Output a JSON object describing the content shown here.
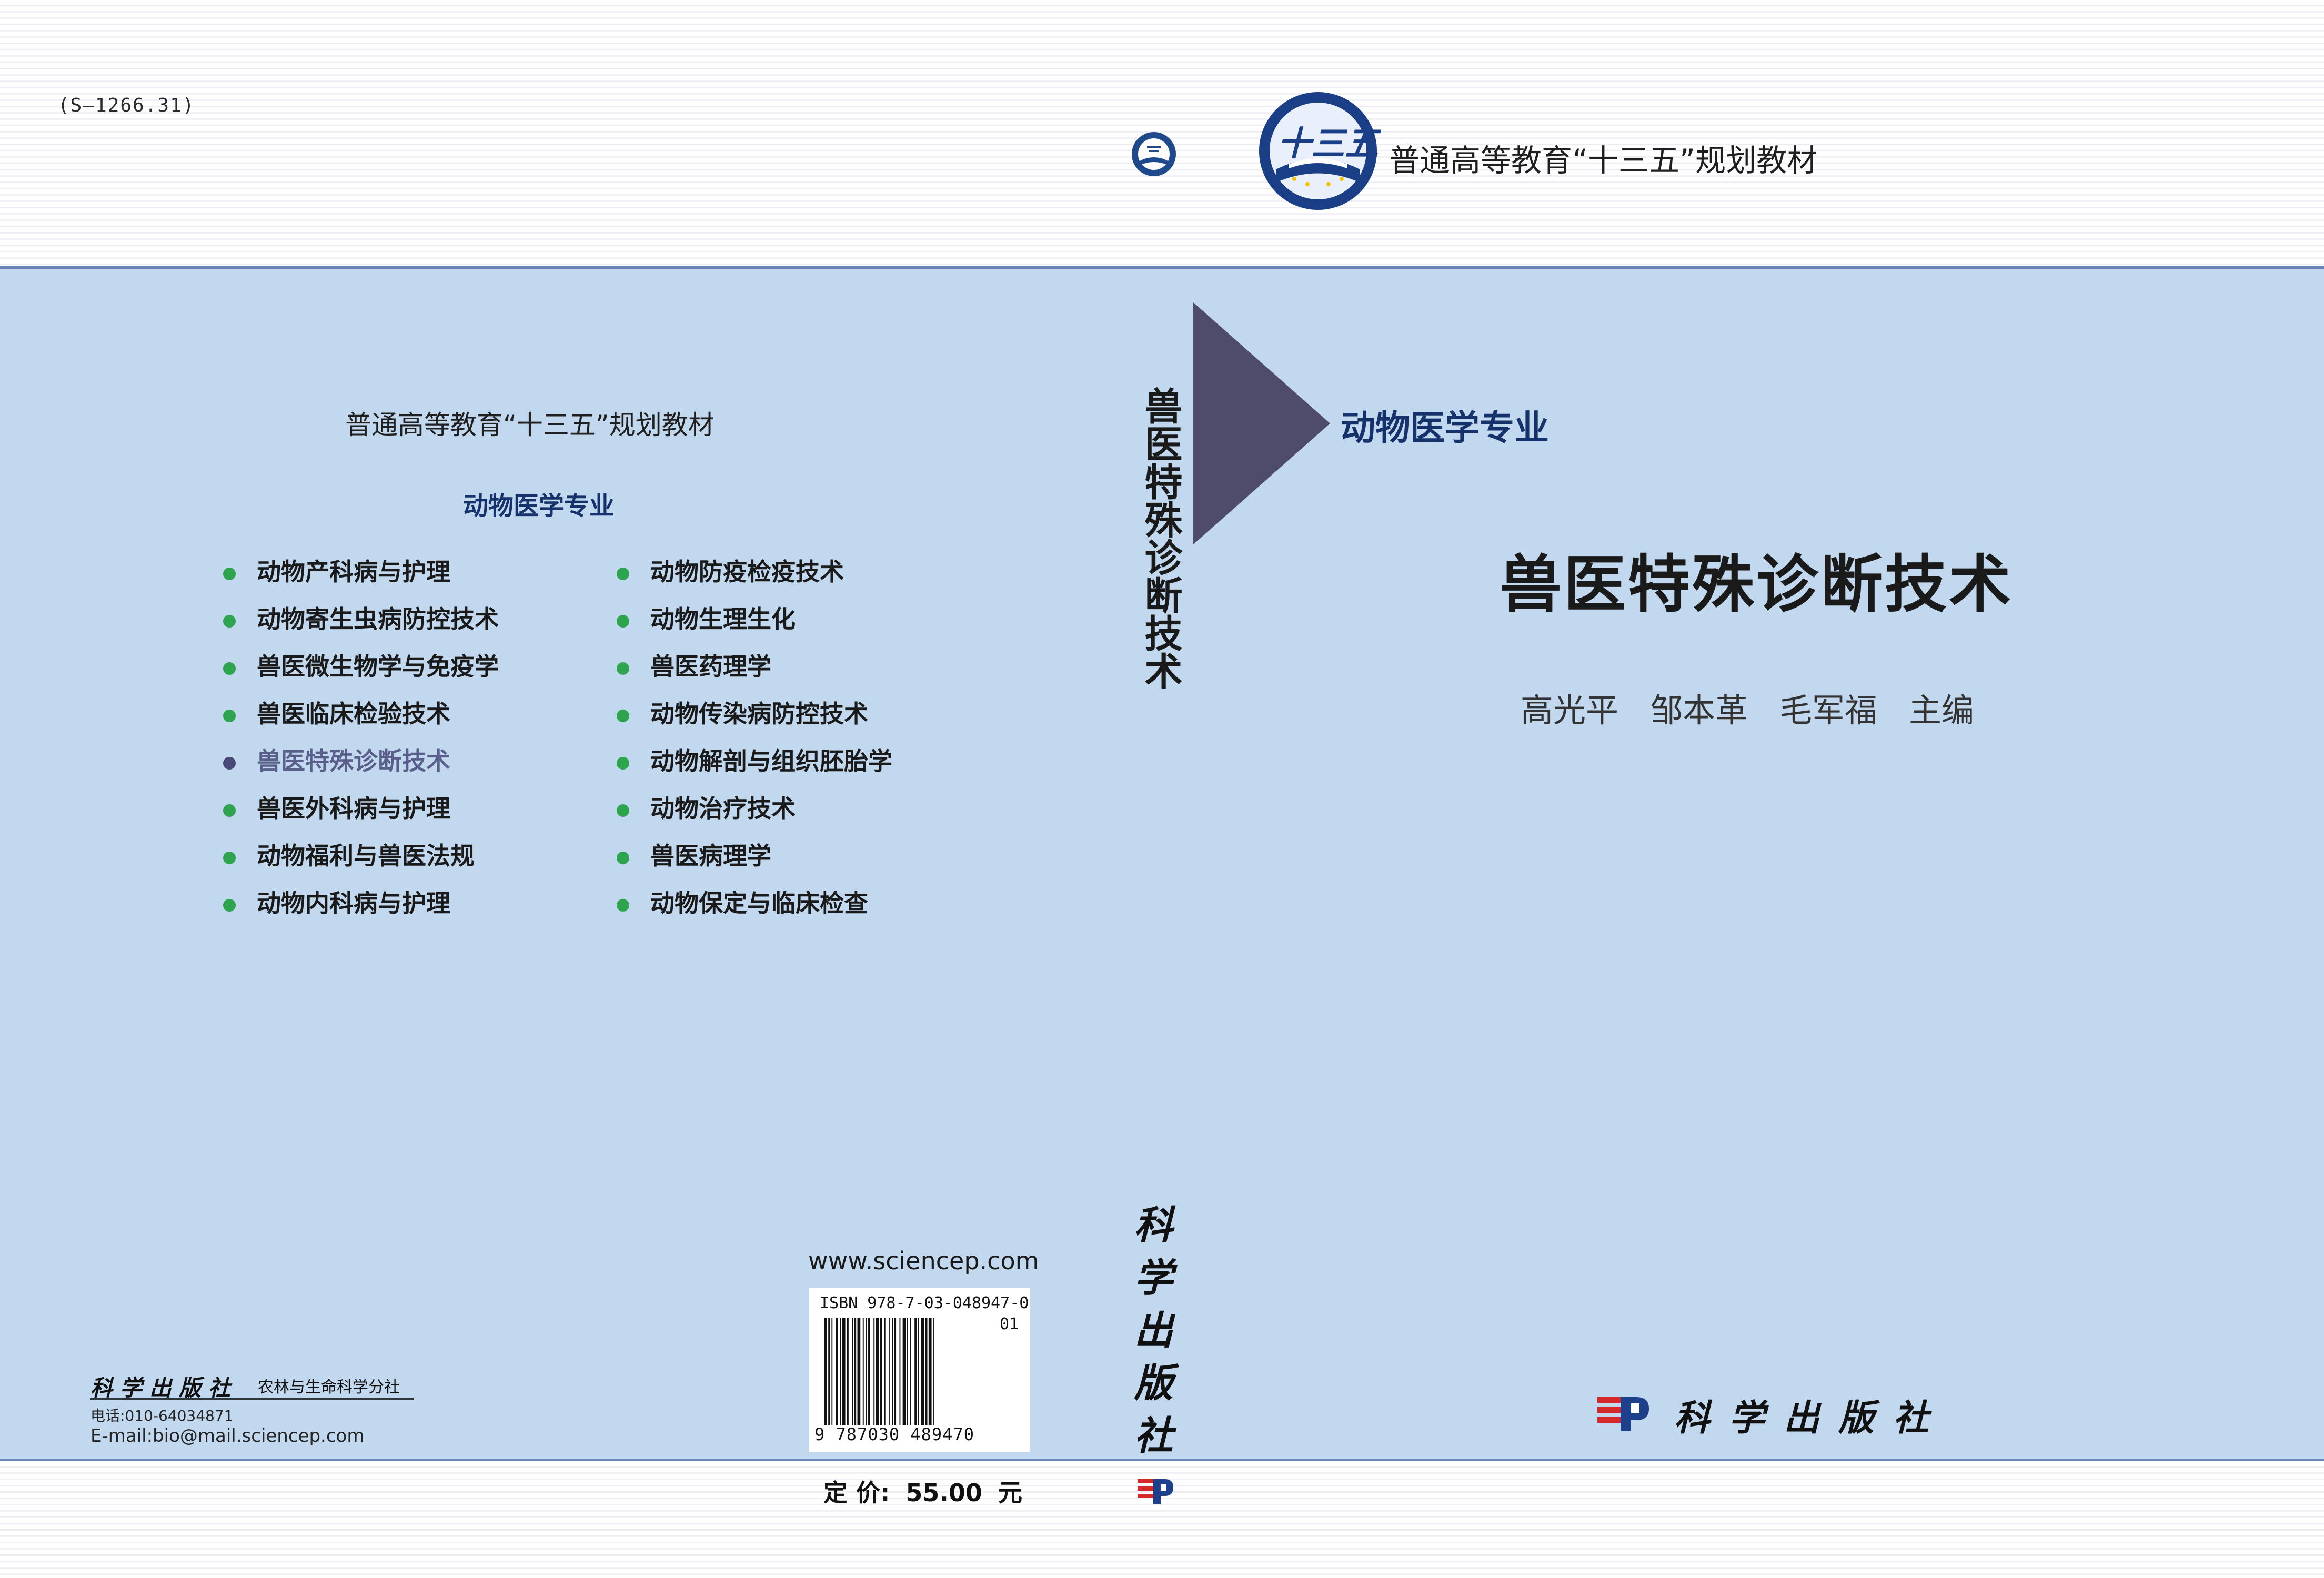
{
  "back": {
    "series_code": "(S—1266.31)",
    "series": "普通高等教育“十三五”规划教材",
    "major": "动物医学专业",
    "books_left": [
      {
        "title": "动物产科病与护理"
      },
      {
        "title": "动物寄生虫病防控技术"
      },
      {
        "title": "兽医微生物学与免疫学"
      },
      {
        "title": "兽医临床检验技术"
      },
      {
        "title": "兽医特殊诊断技术"
      },
      {
        "title": "兽医外科病与护理"
      },
      {
        "title": "动物福利与兽医法规"
      },
      {
        "title": "动物内科病与护理"
      }
    ],
    "books_right": [
      {
        "title": "动物防疫检疫技术"
      },
      {
        "title": "动物生理生化"
      },
      {
        "title": "兽医药理学"
      },
      {
        "title": "动物传染病防控技术"
      },
      {
        "title": "动物解剖与组织胚胎学"
      },
      {
        "title": "动物治疗技术"
      },
      {
        "title": "兽医病理学"
      },
      {
        "title": "动物保定与临床检查"
      }
    ],
    "website": "www.sciencep.com",
    "isbn": "ISBN 978-7-03-048947-0",
    "isbn_addon": "01",
    "barcode_digits": "9 787030 489470",
    "publisher": "科学出版社",
    "division": "农林与生命科学分社",
    "phone": "电话:010-64034871",
    "email": "E-mail:bio@mail.sciencep.com",
    "price_label": "定 价:",
    "price_value": "55.00",
    "price_unit": "元"
  },
  "spine": {
    "title": "兽医特殊诊断技术",
    "publisher": "科学出版社"
  },
  "front": {
    "series": "普通高等教育“十三五”规划教材",
    "logo_text": "十三五",
    "major": "动物医学专业",
    "title": "兽医特殊诊断技术",
    "authors": [
      "高光平",
      "邹本革",
      "毛军福"
    ],
    "editor_role": "主编",
    "publisher": "科学出版社"
  },
  "colors": {
    "panel_blue": "#c1d8ef",
    "rule_blue": "#6c86b7",
    "triangle": "#4f4b6b",
    "bullet_green": "#2ea44f",
    "bullet_current": "#4a4a78",
    "major_navy": "#16326b"
  },
  "icons": {
    "series_logo": "series-emblem-icon",
    "publisher_logo": "sp-publisher-logo-icon"
  }
}
